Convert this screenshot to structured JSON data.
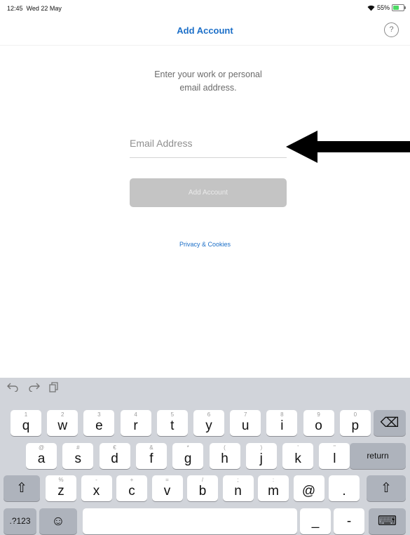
{
  "status": {
    "time": "12:45",
    "date": "Wed 22 May",
    "battery": "55%",
    "battery_level": 0.55
  },
  "nav": {
    "title": "Add Account",
    "help_glyph": "?"
  },
  "prompt_lines": [
    "Enter your work or personal",
    "email address."
  ],
  "email": {
    "placeholder": "Email Address",
    "value": ""
  },
  "add_button_label": "Add Account",
  "privacy_link": "Privacy & Cookies",
  "icons": {
    "undo": "undo-icon",
    "redo": "redo-icon",
    "paste": "paste-icon",
    "wifi": "wifi-icon",
    "battery": "battery-icon",
    "arrow": "pointing-arrow"
  },
  "keyboard": {
    "row1": [
      {
        "main": "q",
        "hint": "1"
      },
      {
        "main": "w",
        "hint": "2"
      },
      {
        "main": "e",
        "hint": "3"
      },
      {
        "main": "r",
        "hint": "4"
      },
      {
        "main": "t",
        "hint": "5"
      },
      {
        "main": "y",
        "hint": "6"
      },
      {
        "main": "u",
        "hint": "7"
      },
      {
        "main": "i",
        "hint": "8"
      },
      {
        "main": "o",
        "hint": "9"
      },
      {
        "main": "p",
        "hint": "0"
      }
    ],
    "row2": [
      {
        "main": "a",
        "hint": "@"
      },
      {
        "main": "s",
        "hint": "#"
      },
      {
        "main": "d",
        "hint": "€"
      },
      {
        "main": "f",
        "hint": "&"
      },
      {
        "main": "g",
        "hint": "*"
      },
      {
        "main": "h",
        "hint": "("
      },
      {
        "main": "j",
        "hint": ")"
      },
      {
        "main": "k",
        "hint": "'"
      },
      {
        "main": "l",
        "hint": "\""
      }
    ],
    "row3": [
      {
        "main": "z",
        "hint": "%"
      },
      {
        "main": "x",
        "hint": "-"
      },
      {
        "main": "c",
        "hint": "+"
      },
      {
        "main": "v",
        "hint": "="
      },
      {
        "main": "b",
        "hint": "/"
      },
      {
        "main": "n",
        "hint": ";"
      },
      {
        "main": "m",
        "hint": ":"
      },
      {
        "main": "@",
        "hint": ""
      },
      {
        "main": ".",
        "hint": ""
      }
    ],
    "backspace": "⌫",
    "return_label": "return",
    "shift": "⇧",
    "numbers_label": ".?123",
    "emoji": "☺",
    "underscore": "_",
    "dash": "-",
    "hide_keyboard": "⌨"
  }
}
